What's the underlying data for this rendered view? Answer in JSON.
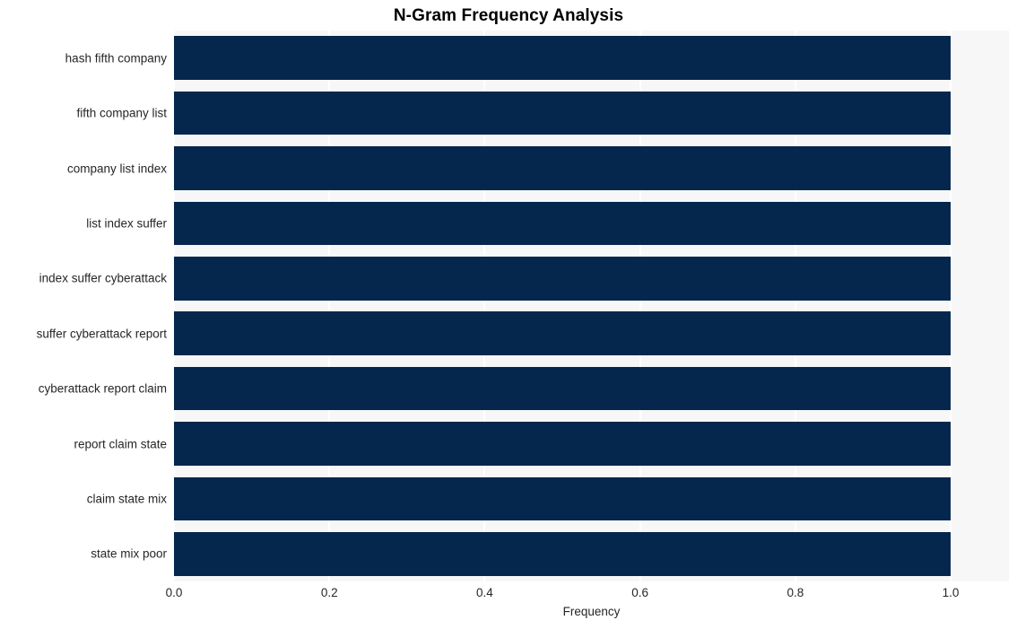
{
  "chart_data": {
    "type": "bar",
    "orientation": "horizontal",
    "title": "N-Gram Frequency Analysis",
    "xlabel": "Frequency",
    "ylabel": "",
    "xlim": [
      0.0,
      1.075
    ],
    "xticks": [
      "0.0",
      "0.2",
      "0.4",
      "0.6",
      "0.8",
      "1.0"
    ],
    "xtick_values": [
      0.0,
      0.2,
      0.4,
      0.6,
      0.8,
      1.0
    ],
    "grid": "vertical-white-on-gray",
    "legend": "none",
    "bar_color": "#05274d",
    "plot_background": "#f7f7f7",
    "figure_background": "#ffffff",
    "categories": [
      "hash fifth company",
      "fifth company list",
      "company list index",
      "list index suffer",
      "index suffer cyberattack",
      "suffer cyberattack report",
      "cyberattack report claim",
      "report claim state",
      "claim state mix",
      "state mix poor"
    ],
    "values": [
      1.0,
      1.0,
      1.0,
      1.0,
      1.0,
      1.0,
      1.0,
      1.0,
      1.0,
      1.0
    ]
  }
}
